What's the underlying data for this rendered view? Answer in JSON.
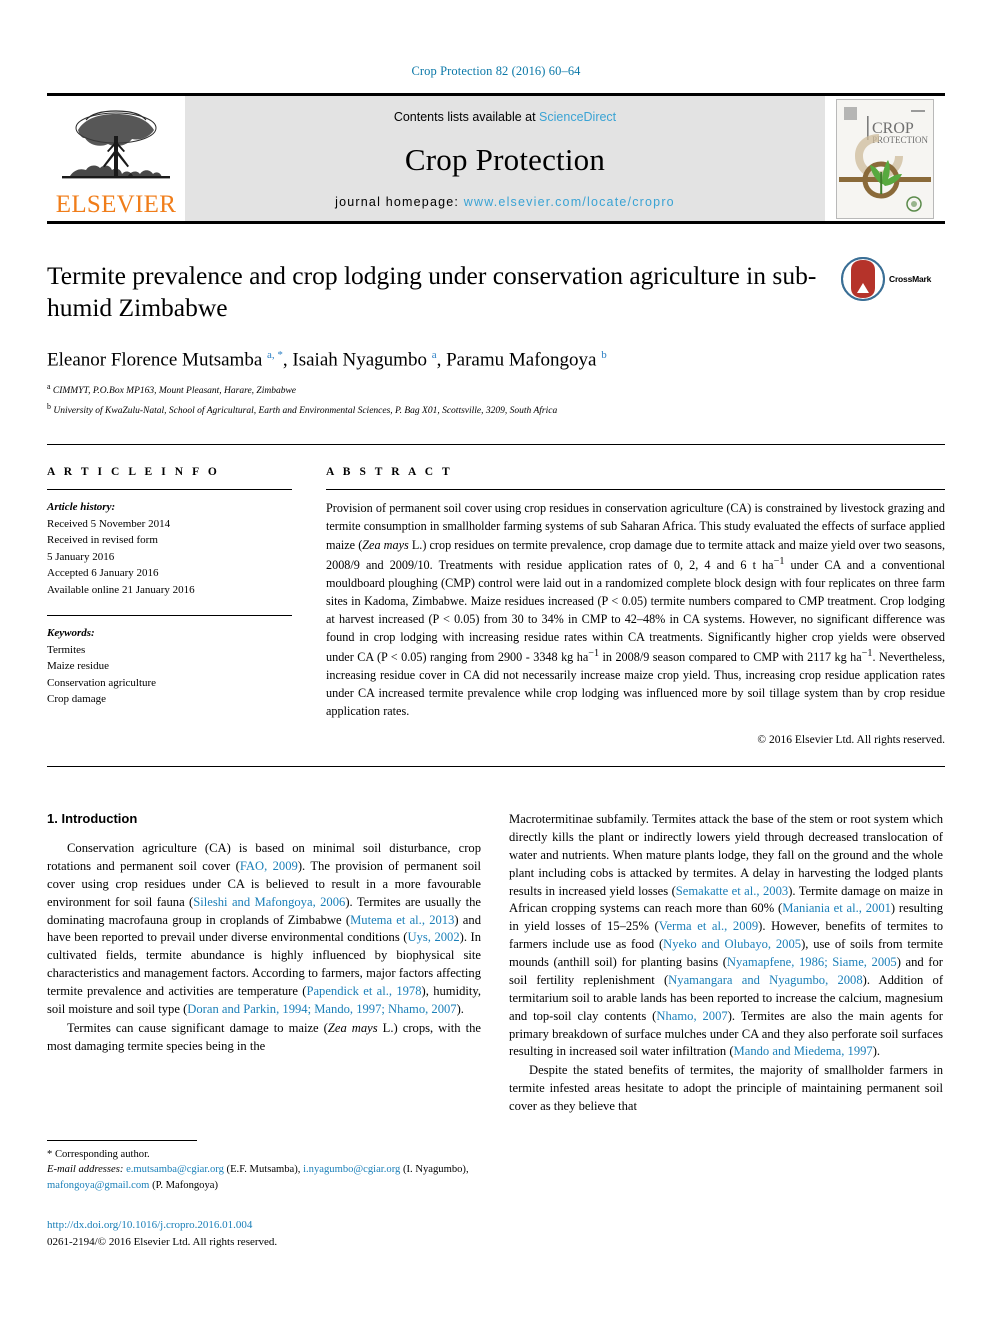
{
  "running_head": "Crop Protection 82 (2016) 60–64",
  "masthead": {
    "publisher_name": "ELSEVIER",
    "contents_prefix": "Contents lists available at ",
    "sciencedirect": "ScienceDirect",
    "journal_name": "Crop Protection",
    "homepage_prefix": "journal homepage: ",
    "homepage_url": "www.elsevier.com/locate/cropro",
    "cover_title_line1": "CROP",
    "cover_title_line2": "PROTECTION"
  },
  "crossmark": {
    "label": "CrossMark"
  },
  "article": {
    "title": "Termite prevalence and crop lodging under conservation agriculture in sub-humid Zimbabwe",
    "authors_html": "Eleanor Florence Mutsamba <sup>a, *</sup>, Isaiah Nyagumbo <sup>a</sup>, Paramu Mafongoya <sup>b</sup>",
    "affiliation_a": "CIMMYT, P.O.Box MP163, Mount Pleasant, Harare, Zimbabwe",
    "affiliation_b": "University of KwaZulu-Natal, School of Agricultural, Earth and Environmental Sciences, P. Bag X01, Scottsville, 3209, South Africa"
  },
  "article_info": {
    "heading": "A R T I C L E   I N F O",
    "history_label": "Article history:",
    "history": [
      "Received 5 November 2014",
      "Received in revised form",
      "5 January 2016",
      "Accepted 6 January 2016",
      "Available online 21 January 2016"
    ],
    "keywords_label": "Keywords:",
    "keywords": [
      "Termites",
      "Maize residue",
      "Conservation agriculture",
      "Crop damage"
    ]
  },
  "abstract": {
    "heading": "A B S T R A C T",
    "text": "Provision of permanent soil cover using crop residues in conservation agriculture (CA) is constrained by livestock grazing and termite consumption in smallholder farming systems of sub Saharan Africa. This study evaluated the effects of surface applied maize (Zea mays L.) crop residues on termite prevalence, crop damage due to termite attack and maize yield over two seasons, 2008/9 and 2009/10. Treatments with residue application rates of 0, 2, 4 and 6 t ha−1 under CA and a conventional mouldboard ploughing (CMP) control were laid out in a randomized complete block design with four replicates on three farm sites in Kadoma, Zimbabwe. Maize residues increased (P < 0.05) termite numbers compared to CMP treatment. Crop lodging at harvest increased (P < 0.05) from 30 to 34% in CMP to 42–48% in CA systems. However, no significant difference was found in crop lodging with increasing residue rates within CA treatments. Significantly higher crop yields were observed under CA (P < 0.05) ranging from 2900 - 3348 kg ha−1 in 2008/9 season compared to CMP with 2117 kg ha−1. Nevertheless, increasing residue cover in CA did not necessarily increase maize crop yield. Thus, increasing crop residue application rates under CA increased termite prevalence while crop lodging was influenced more by soil tillage system than by crop residue application rates.",
    "copyright": "© 2016 Elsevier Ltd. All rights reserved."
  },
  "introduction": {
    "heading": "1. Introduction",
    "left_paragraphs": [
      "Conservation agriculture (CA) is based on minimal soil disturbance, crop rotations and permanent soil cover (FAO, 2009). The provision of permanent soil cover using crop residues under CA is believed to result in a more favourable environment for soil fauna (Sileshi and Mafongoya, 2006). Termites are usually the dominating macrofauna group in croplands of Zimbabwe (Mutema et al., 2013) and have been reported to prevail under diverse environmental conditions (Uys, 2002). In cultivated fields, termite abundance is highly influenced by biophysical site characteristics and management factors. According to farmers, major factors affecting termite prevalence and activities are temperature (Papendick et al., 1978), humidity, soil moisture and soil type (Doran and Parkin, 1994; Mando, 1997; Nhamo, 2007).",
      "Termites can cause significant damage to maize (Zea mays L.) crops, with the most damaging termite species being in the"
    ],
    "right_paragraphs": [
      "Macrotermitinae subfamily. Termites attack the base of the stem or root system which directly kills the plant or indirectly lowers yield through decreased translocation of water and nutrients. When mature plants lodge, they fall on the ground and the whole plant including cobs is attacked by termites. A delay in harvesting the lodged plants results in increased yield losses (Semakatte et al., 2003). Termite damage on maize in African cropping systems can reach more than 60% (Maniania et al., 2001) resulting in yield losses of 15–25% (Verma et al., 2009). However, benefits of termites to farmers include use as food (Nyeko and Olubayo, 2005), use of soils from termite mounds (anthill soil) for planting basins (Nyamapfene, 1986; Siame, 2005) and for soil fertility replenishment (Nyamangara and Nyagumbo, 2008). Addition of termitarium soil to arable lands has been reported to increase the calcium, magnesium and top-soil clay contents (Nhamo, 2007). Termites are also the main agents for primary breakdown of surface mulches under CA and they also perforate soil surfaces resulting in increased soil water infiltration (Mando and Miedema, 1997).",
      "Despite the stated benefits of termites, the majority of smallholder farmers in termite infested areas hesitate to adopt the principle of maintaining permanent soil cover as they believe that"
    ]
  },
  "footnotes": {
    "corresponding_author": "* Corresponding author.",
    "email_label": "E-mail addresses:",
    "emails": [
      {
        "address": "e.mutsamba@cgiar.org",
        "owner": "(E.F. Mutsamba)"
      },
      {
        "address": "i.nyagumbo@cgiar.org",
        "owner": "(I. Nyagumbo)"
      },
      {
        "address": "mafongoya@gmail.com",
        "owner": "(P. Mafongoya)"
      }
    ],
    "doi": "http://dx.doi.org/10.1016/j.cropro.2016.01.004",
    "issn_line": "0261-2194/© 2016 Elsevier Ltd. All rights reserved."
  },
  "colors": {
    "link_blue": "#1a7fb8",
    "header_blue": "#0b78a8",
    "elsevier_orange": "#f07d1a",
    "masthead_grey": "#e3e3e3",
    "crossmark_red": "#b5332a"
  }
}
